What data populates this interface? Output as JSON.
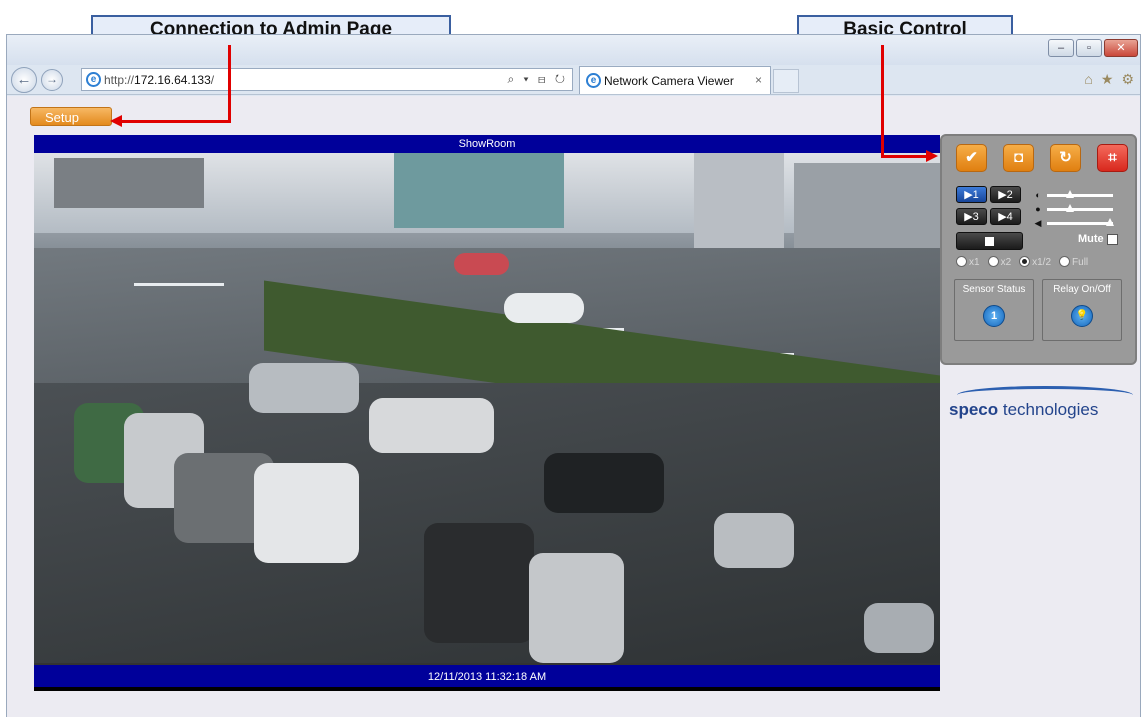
{
  "callouts": {
    "admin": "Connection to Admin Page",
    "basic": "Basic Control"
  },
  "browser": {
    "url_protocol": "http://",
    "url_host": "172.16.64.133",
    "url_path": "/",
    "address_tools": "⌕ ▾ ⊟ ↻",
    "tab_title": "Network Camera Viewer",
    "tab_close": "×",
    "back_glyph": "←",
    "forward_glyph": "→",
    "window_buttons": [
      "–",
      "▫",
      "✕"
    ],
    "right_icons": [
      "home-icon",
      "star-icon",
      "gear-icon"
    ],
    "right_glyphs": [
      "⌂",
      "★",
      "⚙"
    ]
  },
  "page": {
    "setup_label": "Setup",
    "camera_name": "ShowRoom",
    "timestamp": "12/11/2013 11:32:18 AM"
  },
  "control_panel": {
    "top_buttons": [
      {
        "name": "ptz-icon",
        "glyph": "✔"
      },
      {
        "name": "snapshot-camera-icon",
        "glyph": "◘"
      },
      {
        "name": "refresh-icon",
        "glyph": "↻"
      },
      {
        "name": "crop-icon",
        "glyph": "⌗"
      }
    ],
    "channels": [
      "1",
      "2",
      "3",
      "4"
    ],
    "active_channel": "1",
    "channel_prefix": "▶",
    "sliders": [
      {
        "name": "brightness-slider",
        "glyph": "◐",
        "level": 0.35
      },
      {
        "name": "contrast-slider",
        "glyph": "●",
        "level": 0.35
      },
      {
        "name": "volume-slider",
        "glyph": "◀",
        "level": 0.95
      }
    ],
    "mute_label": "Mute",
    "zoom_options": [
      "x1",
      "x2",
      "x1/2",
      "Full"
    ],
    "zoom_selected": "x1/2",
    "sensor_status_label": "Sensor Status",
    "sensor_value": "1",
    "relay_label": "Relay On/Off",
    "relay_glyph": "💡"
  },
  "logo": {
    "brand_bold": "speco",
    "brand_rest": " technologies"
  },
  "colors": {
    "header_bar": "#00009a",
    "accent_orange": "#e38a1e",
    "callout_arrow": "#e00000"
  }
}
